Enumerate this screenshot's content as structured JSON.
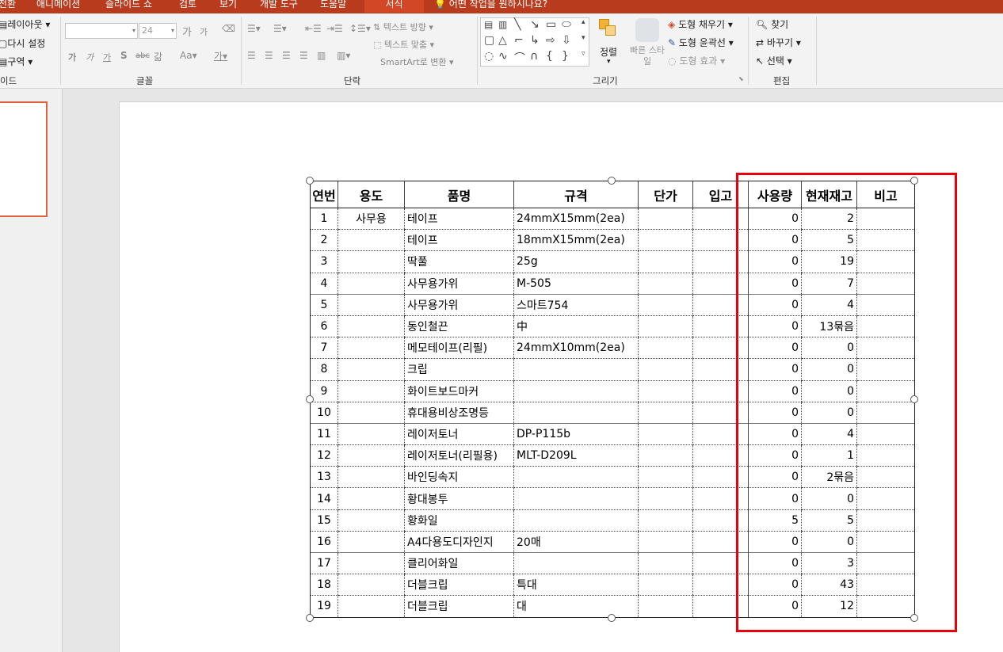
{
  "tabs": [
    "전환",
    "애니메이션",
    "슬라이드 쇼",
    "검토",
    "보기",
    "개발 도구",
    "도움말",
    "서식"
  ],
  "active_tab": "서식",
  "tell_me": "어떤 작업을 원하시나요?",
  "ribbon": {
    "slides": {
      "layout": "레이아웃",
      "reset": "다시 설정",
      "section": "구역",
      "label": "이드"
    },
    "font": {
      "size": "24",
      "grow": "가",
      "shrink": "가",
      "bold": "가",
      "italic": "가",
      "underline": "가",
      "shadow": "S",
      "strike": "abc",
      "spacing": "갊",
      "case": "Aa",
      "color": "가",
      "label": "글꼴"
    },
    "paragraph": {
      "text_direction": "텍스트 방향",
      "align_text": "텍스트 맞춤",
      "smartart": "SmartArt로 변환",
      "label": "단락"
    },
    "drawing": {
      "arrange": "정렬",
      "quick_styles": "빠른 스타일",
      "fill": "도형 채우기",
      "outline": "도형 윤곽선",
      "effects": "도형 효과",
      "label": "그리기"
    },
    "editing": {
      "find": "찾기",
      "replace": "바꾸기",
      "select": "선택",
      "label": "편집"
    }
  },
  "table": {
    "headers": [
      "연번",
      "용도",
      "품명",
      "규격",
      "단가",
      "입고",
      "사용량",
      "현재재고",
      "비고"
    ],
    "rows": [
      {
        "no": "1",
        "purpose": "사무용",
        "name": "테이프",
        "spec": "24mmX15mm(2ea)",
        "use": "0",
        "stock": "2"
      },
      {
        "no": "2",
        "purpose": "",
        "name": "테이프",
        "spec": "18mmX15mm(2ea)",
        "use": "0",
        "stock": "5"
      },
      {
        "no": "3",
        "purpose": "",
        "name": "딱풀",
        "spec": "25g",
        "use": "0",
        "stock": "19"
      },
      {
        "no": "4",
        "purpose": "",
        "name": "사무용가위",
        "spec": "M-505",
        "use": "0",
        "stock": "7"
      },
      {
        "no": "5",
        "purpose": "",
        "name": "사무용가위",
        "spec": "스마트754",
        "use": "0",
        "stock": "4"
      },
      {
        "no": "6",
        "purpose": "",
        "name": "동인철끈",
        "spec": "中",
        "use": "0",
        "stock": "13묶음"
      },
      {
        "no": "7",
        "purpose": "",
        "name": "메모테이프(리필)",
        "spec": "24mmX10mm(2ea)",
        "use": "0",
        "stock": "0"
      },
      {
        "no": "8",
        "purpose": "",
        "name": "크립",
        "spec": "",
        "use": "0",
        "stock": "0"
      },
      {
        "no": "9",
        "purpose": "",
        "name": "화이트보드마커",
        "spec": "",
        "use": "0",
        "stock": "0"
      },
      {
        "no": "10",
        "purpose": "",
        "name": "휴대용비상조명등",
        "spec": "",
        "use": "0",
        "stock": "0"
      },
      {
        "no": "11",
        "purpose": "",
        "name": "레이저토너",
        "spec": "DP-P115b",
        "use": "0",
        "stock": "4"
      },
      {
        "no": "12",
        "purpose": "",
        "name": "레이저토너(리필용)",
        "spec": "MLT-D209L",
        "use": "0",
        "stock": "1"
      },
      {
        "no": "13",
        "purpose": "",
        "name": "바인딩속지",
        "spec": "",
        "use": "0",
        "stock": "2묶음"
      },
      {
        "no": "14",
        "purpose": "",
        "name": "황대봉투",
        "spec": "",
        "use": "0",
        "stock": "0"
      },
      {
        "no": "15",
        "purpose": "",
        "name": "황화일",
        "spec": "",
        "use": "5",
        "stock": "5"
      },
      {
        "no": "16",
        "purpose": "",
        "name": "A4다용도디자인지",
        "spec": "20매",
        "use": "0",
        "stock": "0"
      },
      {
        "no": "17",
        "purpose": "",
        "name": "클리어화일",
        "spec": "",
        "use": "0",
        "stock": "3"
      },
      {
        "no": "18",
        "purpose": "",
        "name": "더블크립",
        "spec": "특대",
        "use": "0",
        "stock": "43"
      },
      {
        "no": "19",
        "purpose": "",
        "name": "더블크립",
        "spec": "대",
        "use": "0",
        "stock": "12"
      }
    ]
  },
  "colors": {
    "title_bar": "#b83b1e",
    "active_tab": "#d24726",
    "highlight_box": "#e8000b",
    "thumb_border": "#e0633f"
  }
}
